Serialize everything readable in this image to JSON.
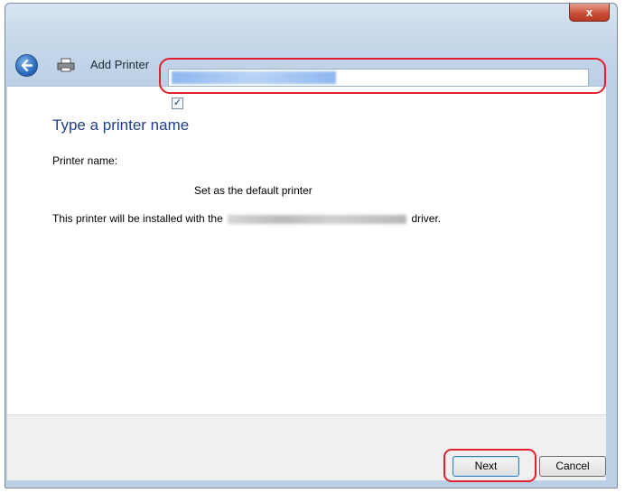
{
  "window": {
    "title": "Add Printer",
    "close_label": "x"
  },
  "main": {
    "heading": "Type a printer name",
    "printer_name_label": "Printer name:",
    "printer_name_value": "",
    "default_checkbox": {
      "label": "Set as the default printer",
      "checked": true
    },
    "install_text_prefix": "This printer will be installed with the",
    "install_text_suffix": "driver."
  },
  "footer": {
    "next_label": "Next",
    "cancel_label": "Cancel"
  },
  "colors": {
    "highlight": "#e0202e",
    "heading": "#1f3f8b",
    "chrome": "#c7d8ea"
  }
}
